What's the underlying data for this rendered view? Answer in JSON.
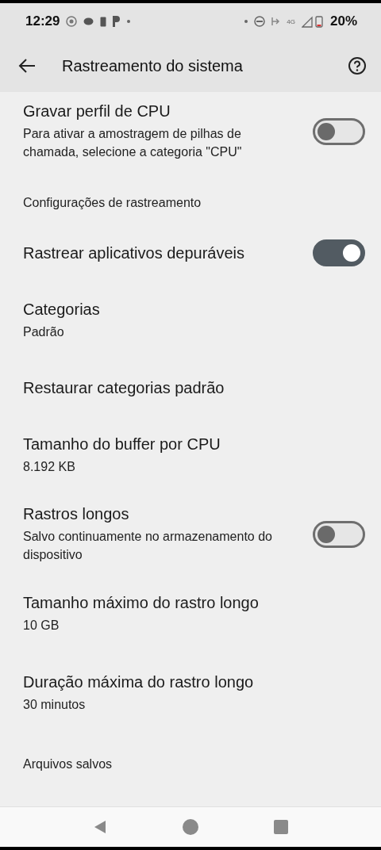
{
  "status_bar": {
    "time": "12:29",
    "network": "4G",
    "battery": "20%"
  },
  "app_bar": {
    "title": "Rastreamento do sistema"
  },
  "items": [
    {
      "kind": "switch",
      "title": "Gravar perfil de CPU",
      "summary": "Para ativar a amostragem de pilhas de chamada, selecione a categoria \"CPU\"",
      "on": false
    },
    {
      "kind": "header",
      "title": "Configurações de rastreamento"
    },
    {
      "kind": "switch",
      "title": "Rastrear aplicativos depuráveis",
      "on": true
    },
    {
      "kind": "item",
      "title": "Categorias",
      "summary": "Padrão"
    },
    {
      "kind": "item",
      "title": "Restaurar categorias padrão"
    },
    {
      "kind": "item",
      "title": "Tamanho do buffer por CPU",
      "summary": "8.192 KB"
    },
    {
      "kind": "switch",
      "title": "Rastros longos",
      "summary": "Salvo continuamente no armazenamento do dispositivo",
      "on": false
    },
    {
      "kind": "item",
      "title": "Tamanho máximo do rastro longo",
      "summary": "10 GB"
    },
    {
      "kind": "item",
      "title": "Duração máxima do rastro longo",
      "summary": "30 minutos"
    },
    {
      "kind": "header",
      "title": "Arquivos salvos"
    }
  ]
}
